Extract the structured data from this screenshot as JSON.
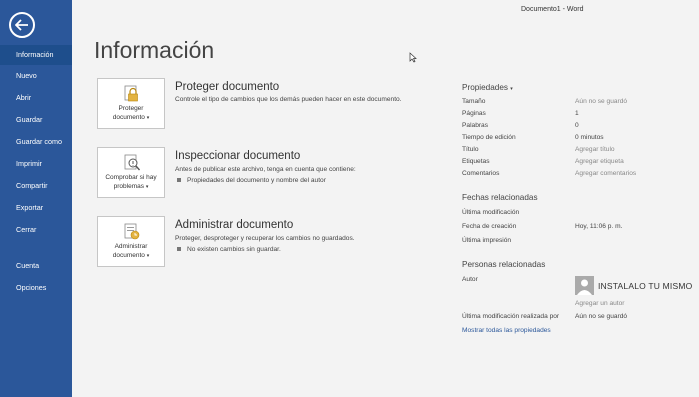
{
  "window": {
    "title": "Documento1 - Word"
  },
  "sidebar": {
    "items": [
      {
        "label": "Información"
      },
      {
        "label": "Nuevo"
      },
      {
        "label": "Abrir"
      },
      {
        "label": "Guardar"
      },
      {
        "label": "Guardar como"
      },
      {
        "label": "Imprimir"
      },
      {
        "label": "Compartir"
      },
      {
        "label": "Exportar"
      },
      {
        "label": "Cerrar"
      },
      {
        "label": "Cuenta"
      },
      {
        "label": "Opciones"
      }
    ]
  },
  "page": {
    "title": "Información"
  },
  "sections": {
    "protect": {
      "tile_line1": "Proteger",
      "tile_line2": "documento",
      "title": "Proteger documento",
      "desc": "Controle el tipo de cambios que los demás pueden hacer en este documento."
    },
    "inspect": {
      "tile_line1": "Comprobar si hay",
      "tile_line2": "problemas",
      "title": "Inspeccionar documento",
      "desc": "Antes de publicar este archivo, tenga en cuenta que contiene:",
      "bullet": "Propiedades del documento y nombre del autor"
    },
    "manage": {
      "tile_line1": "Administrar",
      "tile_line2": "documento",
      "title": "Administrar documento",
      "desc": "Proteger, desproteger y recuperar los cambios no guardados.",
      "bullet": "No existen cambios sin guardar."
    }
  },
  "properties": {
    "header": "Propiedades",
    "rows": [
      {
        "label": "Tamaño",
        "value": "Aún no se guardó"
      },
      {
        "label": "Páginas",
        "value": "1"
      },
      {
        "label": "Palabras",
        "value": "0"
      },
      {
        "label": "Tiempo de edición",
        "value": "0 minutos"
      },
      {
        "label": "Título",
        "value": "Agregar título"
      },
      {
        "label": "Etiquetas",
        "value": "Agregar etiqueta"
      },
      {
        "label": "Comentarios",
        "value": "Agregar comentarios"
      }
    ]
  },
  "dates": {
    "header": "Fechas relacionadas",
    "rows": [
      {
        "label": "Última modificación",
        "value": ""
      },
      {
        "label": "Fecha de creación",
        "value": "Hoy, 11:06 p. m."
      },
      {
        "label": "Última impresión",
        "value": ""
      }
    ]
  },
  "people": {
    "header": "Personas relacionadas",
    "author_label": "Autor",
    "author_name": "INSTALALO TU MISMO",
    "add_author": "Agregar un autor",
    "last_modified_by_label": "Última modificación realizada por",
    "last_modified_by_value": "Aún no se guardó",
    "show_all": "Mostrar todas las propiedades"
  }
}
